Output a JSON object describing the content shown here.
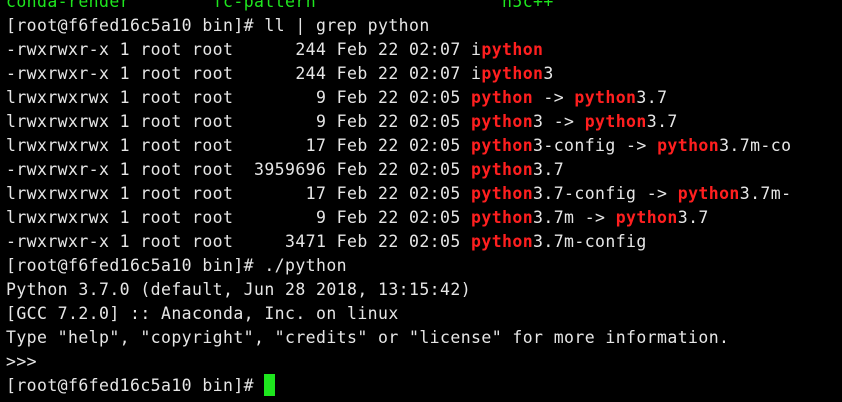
{
  "terminal": {
    "colors": {
      "background": "#000000",
      "text": "#e6e6e6",
      "match_highlight": "#ff1f1f",
      "green": "#1ee61e",
      "cursor": "#1ee61e"
    },
    "lines": [
      [
        {
          "t": "conda-render",
          "c": "green"
        },
        {
          "t": "        ",
          "c": "plain"
        },
        {
          "t": "fc-pattern",
          "c": "green"
        },
        {
          "t": "                  ",
          "c": "plain"
        },
        {
          "t": "h5c++",
          "c": "green"
        }
      ],
      [
        {
          "t": "[root@f6fed16c5a10 bin]# ll | grep python",
          "c": "plain"
        }
      ],
      [
        {
          "t": "-rwxrwxr-x 1 root root      244 Feb 22 02:07 i",
          "c": "plain"
        },
        {
          "t": "python",
          "c": "red"
        }
      ],
      [
        {
          "t": "-rwxrwxr-x 1 root root      244 Feb 22 02:07 i",
          "c": "plain"
        },
        {
          "t": "python",
          "c": "red"
        },
        {
          "t": "3",
          "c": "plain"
        }
      ],
      [
        {
          "t": "lrwxrwxrwx 1 root root        9 Feb 22 02:05 ",
          "c": "plain"
        },
        {
          "t": "python",
          "c": "red"
        },
        {
          "t": " -> ",
          "c": "plain"
        },
        {
          "t": "python",
          "c": "red"
        },
        {
          "t": "3.7",
          "c": "plain"
        }
      ],
      [
        {
          "t": "lrwxrwxrwx 1 root root        9 Feb 22 02:05 ",
          "c": "plain"
        },
        {
          "t": "python",
          "c": "red"
        },
        {
          "t": "3 -> ",
          "c": "plain"
        },
        {
          "t": "python",
          "c": "red"
        },
        {
          "t": "3.7",
          "c": "plain"
        }
      ],
      [
        {
          "t": "lrwxrwxrwx 1 root root       17 Feb 22 02:05 ",
          "c": "plain"
        },
        {
          "t": "python",
          "c": "red"
        },
        {
          "t": "3-config -> ",
          "c": "plain"
        },
        {
          "t": "python",
          "c": "red"
        },
        {
          "t": "3.7m-co",
          "c": "plain"
        }
      ],
      [
        {
          "t": "-rwxrwxr-x 1 root root  3959696 Feb 22 02:05 ",
          "c": "plain"
        },
        {
          "t": "python",
          "c": "red"
        },
        {
          "t": "3.7",
          "c": "plain"
        }
      ],
      [
        {
          "t": "lrwxrwxrwx 1 root root       17 Feb 22 02:05 ",
          "c": "plain"
        },
        {
          "t": "python",
          "c": "red"
        },
        {
          "t": "3.7-config -> ",
          "c": "plain"
        },
        {
          "t": "python",
          "c": "red"
        },
        {
          "t": "3.7m-",
          "c": "plain"
        }
      ],
      [
        {
          "t": "lrwxrwxrwx 1 root root        9 Feb 22 02:05 ",
          "c": "plain"
        },
        {
          "t": "python",
          "c": "red"
        },
        {
          "t": "3.7m -> ",
          "c": "plain"
        },
        {
          "t": "python",
          "c": "red"
        },
        {
          "t": "3.7",
          "c": "plain"
        }
      ],
      [
        {
          "t": "-rwxrwxr-x 1 root root     3471 Feb 22 02:05 ",
          "c": "plain"
        },
        {
          "t": "python",
          "c": "red"
        },
        {
          "t": "3.7m-config",
          "c": "plain"
        }
      ],
      [
        {
          "t": "[root@f6fed16c5a10 bin]# ./python",
          "c": "plain"
        }
      ],
      [
        {
          "t": "Python 3.7.0 (default, Jun 28 2018, 13:15:42)",
          "c": "plain"
        }
      ],
      [
        {
          "t": "[GCC 7.2.0] :: Anaconda, Inc. on linux",
          "c": "plain"
        }
      ],
      [
        {
          "t": "Type \"help\", \"copyright\", \"credits\" or \"license\" for more information.",
          "c": "plain"
        }
      ],
      [
        {
          "t": ">>>",
          "c": "plain"
        }
      ],
      [
        {
          "t": "[root@f6fed16c5a10 bin]# ",
          "c": "plain"
        }
      ]
    ],
    "cursor_on_last_line": true
  }
}
